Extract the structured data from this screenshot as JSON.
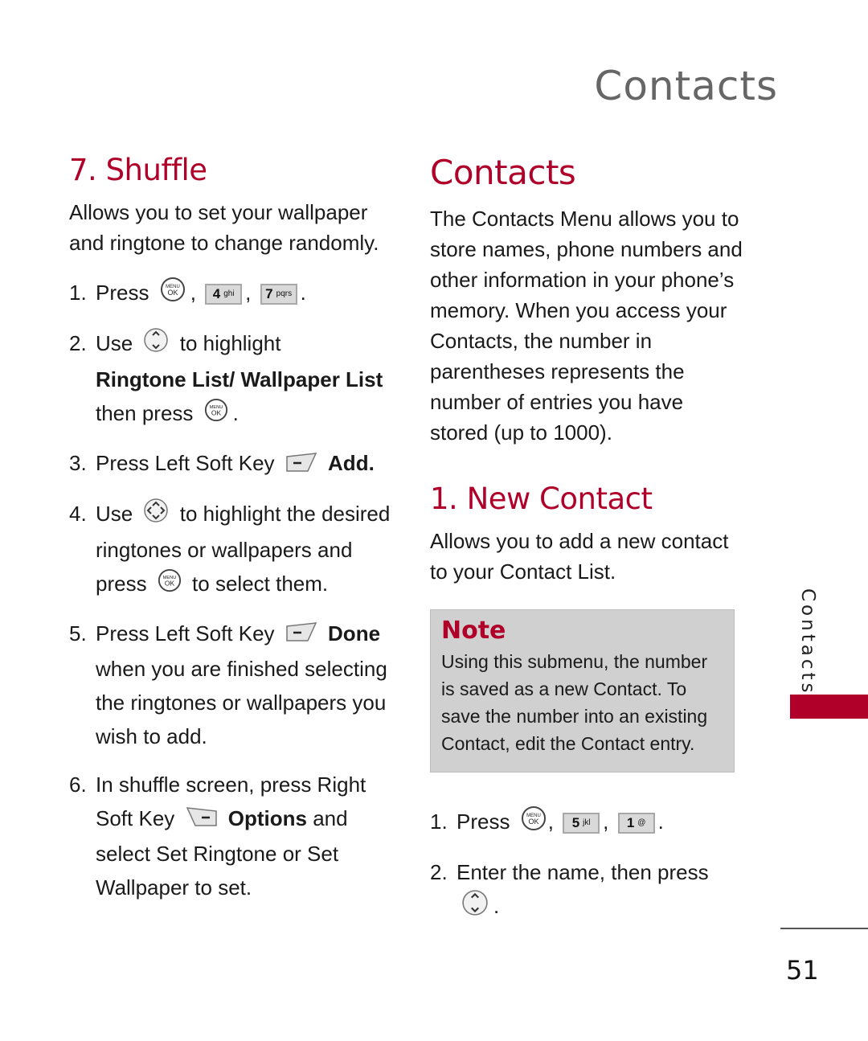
{
  "header": {
    "title": "Contacts"
  },
  "left": {
    "heading": "7. Shuffle",
    "intro": "Allows you to set your wallpaper and ringtone to change randomly.",
    "steps": [
      {
        "num": "1.",
        "text_a": "Press",
        "sep1": ",",
        "key1_main": "4",
        "key1_sub": "ghi",
        "sep2": ",",
        "key2_main": "7",
        "key2_sub": "pqrs",
        "end": "."
      },
      {
        "num": "2.",
        "text_a": "Use",
        "text_b": "to highlight",
        "bold": "Ringtone List/ Wallpaper List",
        "text_c": "then press",
        "end": "."
      },
      {
        "num": "3.",
        "text_a": "Press Left Soft Key",
        "bold": "Add."
      },
      {
        "num": "4.",
        "text_a": "Use",
        "text_b": "to highlight the desired ringtones or wallpapers and press",
        "text_c": "to select them."
      },
      {
        "num": "5.",
        "text_a": "Press Left Soft Key",
        "bold": "Done",
        "text_b": "when you are finished selecting the ringtones or wallpapers you wish to add."
      },
      {
        "num": "6.",
        "text_a": "In shuffle screen, press Right Soft Key",
        "bold": "Options",
        "text_b": "and select Set Ringtone or Set Wallpaper to set."
      }
    ]
  },
  "right": {
    "heading": "Contacts",
    "intro": "The Contacts Menu allows you to store names, phone numbers and other information in your phone’s memory. When you access your Contacts, the number in parentheses represents the number of entries you have stored (up to 1000).",
    "sub_heading": "1. New Contact",
    "sub_intro": "Allows you to add a new contact to your Contact List.",
    "note": {
      "title": "Note",
      "text": "Using this submenu, the number is saved as a new Contact. To save the number into an existing Contact, edit the Contact entry."
    },
    "steps": [
      {
        "num": "1.",
        "text_a": "Press",
        "sep1": ",",
        "key1_main": "5",
        "key1_sub": "jkl",
        "sep2": ",",
        "key2_main": "1",
        "key2_sub": "@",
        "end": "."
      },
      {
        "num": "2.",
        "text_a": "Enter the name, then press",
        "end": "."
      }
    ]
  },
  "icons": {
    "menu_ok_top": "MENU",
    "menu_ok_bottom": "OK"
  },
  "side_tab": {
    "label": "Contacts"
  },
  "page_number": "51",
  "colors": {
    "accent": "#b0002a",
    "note_bg": "#d0d0d0",
    "header_gray": "#666666"
  }
}
